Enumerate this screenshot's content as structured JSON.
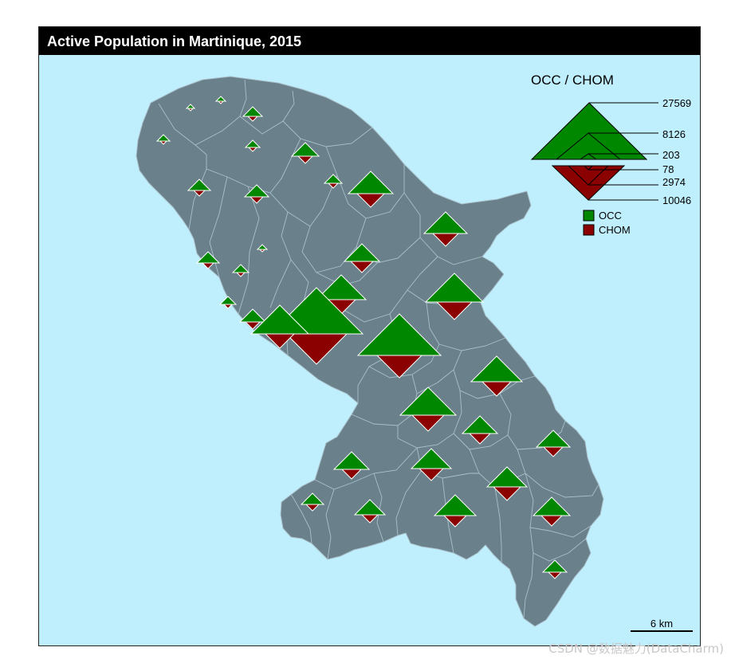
{
  "title": "Active Population in Martinique, 2015",
  "colors": {
    "sea": "#bfeefd",
    "land": "#6a808a",
    "border": "#a9c1cc",
    "occ": "#008700",
    "chom": "#8b0000"
  },
  "legend": {
    "title": "OCC / CHOM",
    "occ_values": [
      "27569",
      "8126",
      "203"
    ],
    "chom_values": [
      "78",
      "2974",
      "10046"
    ],
    "items": [
      {
        "key": "occ",
        "label": "OCC"
      },
      {
        "key": "chom",
        "label": "CHOM"
      }
    ]
  },
  "scale_bar": {
    "label": "6 km"
  },
  "watermark": "CSDN @数据魅力(DataCharm)"
}
